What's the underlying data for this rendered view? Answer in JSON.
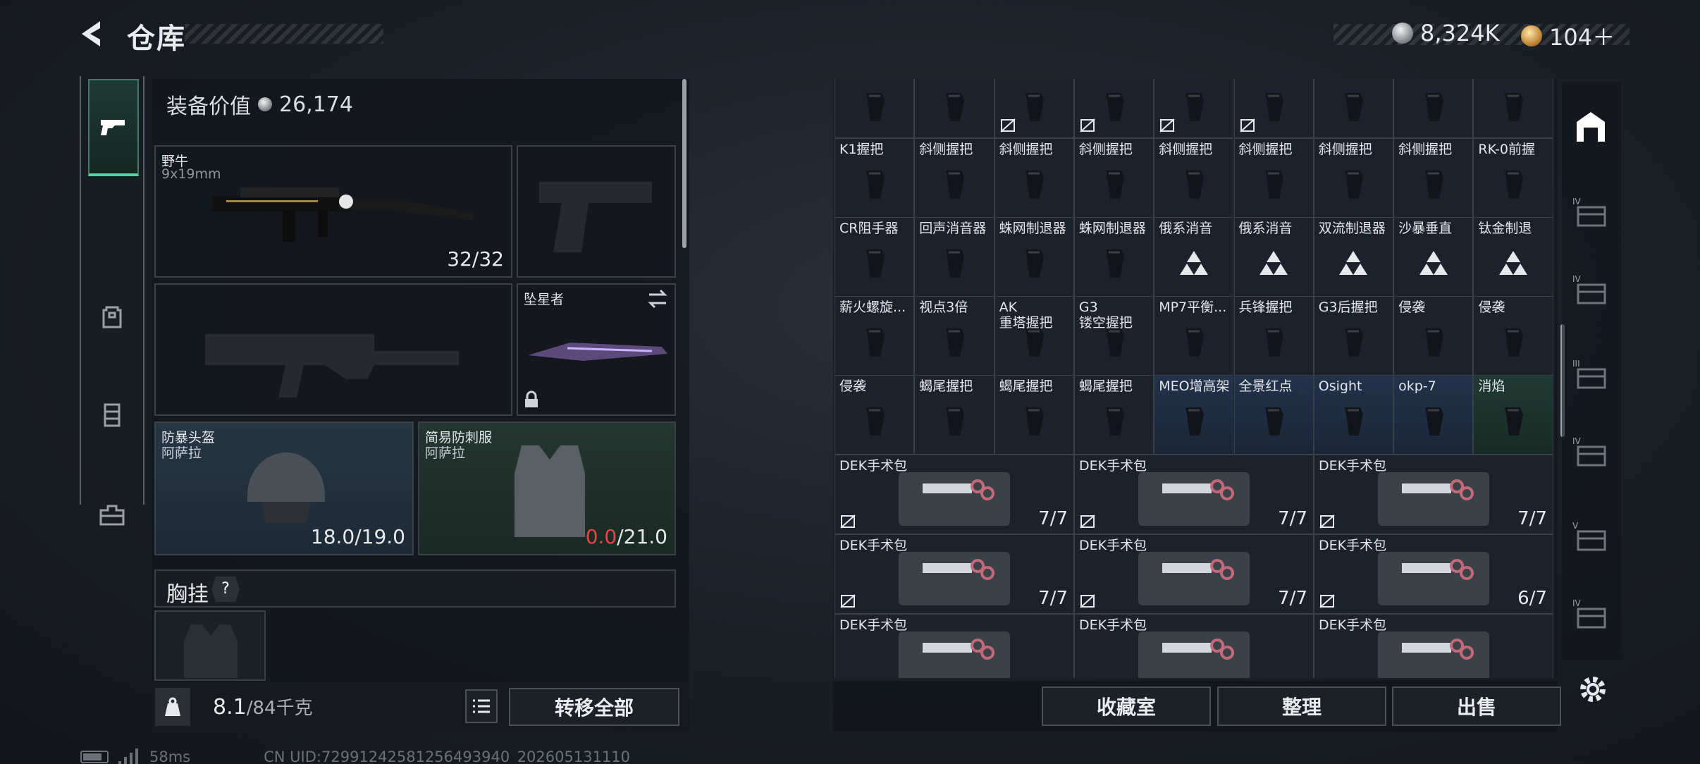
{
  "header": {
    "title": "仓库"
  },
  "currency": {
    "silver": "8,324K",
    "gold": "104＋"
  },
  "equipment": {
    "value_label": "装备价值",
    "value": "26,174",
    "primary": {
      "name": "野牛",
      "ammo": "9x19mm",
      "count": "32/32"
    },
    "melee": {
      "name": "坠星者"
    },
    "helmet": {
      "name": "防暴头盔",
      "brand": "阿萨拉",
      "count": "18.0/19.0"
    },
    "armor": {
      "name": "简易防刺服",
      "brand": "阿萨拉",
      "count_current": "0.0",
      "count_max": "/21.0"
    },
    "chest_label": "胸挂",
    "chest_help": "?"
  },
  "bottom_left": {
    "weight": "8.1",
    "weight_max": "/84千克",
    "transfer_all": "转移全部"
  },
  "status": {
    "ping": "58ms",
    "uid": "CN UID:72991242581256493940_202605131110"
  },
  "grid": {
    "row1": [
      "",
      "",
      "",
      "",
      "",
      "",
      "",
      "",
      ""
    ],
    "row2": [
      "K1握把",
      "斜侧握把",
      "斜侧握把",
      "斜侧握把",
      "斜侧握把",
      "斜侧握把",
      "斜侧握把",
      "斜侧握把",
      "RK-0前握"
    ],
    "row3": [
      "CR阻手器",
      "回声消音器",
      "蛛网制退器",
      "蛛网制退器",
      "俄系消音",
      "俄系消音",
      "双流制退器",
      "沙暴垂直",
      "钛金制退"
    ],
    "row4": [
      "薪火螺旋...",
      "视点3倍",
      "AK\n重塔握把",
      "G3\n镂空握把",
      "MP7平衡...",
      "兵锋握把",
      "G3后握把",
      "侵袭",
      "侵袭"
    ],
    "row5": [
      "侵袭",
      "蝎尾握把",
      "蝎尾握把",
      "蝎尾握把",
      "MEO增高架",
      "全景红点",
      "Osight",
      "okp-7",
      "消焰"
    ],
    "kits": [
      {
        "name": "DEK手术包",
        "count": "7/7"
      },
      {
        "name": "DEK手术包",
        "count": "7/7"
      },
      {
        "name": "DEK手术包",
        "count": "7/7"
      },
      {
        "name": "DEK手术包",
        "count": "7/7"
      },
      {
        "name": "DEK手术包",
        "count": "7/7"
      },
      {
        "name": "DEK手术包",
        "count": "6/7"
      },
      {
        "name": "DEK手术包",
        "count": ""
      },
      {
        "name": "DEK手术包",
        "count": ""
      },
      {
        "name": "DEK手术包",
        "count": ""
      }
    ]
  },
  "buttons": {
    "vault": "收藏室",
    "sort": "整理",
    "sell": "出售"
  },
  "right_tabs": [
    "IV",
    "IV",
    "III",
    "IV",
    "V",
    "IV"
  ]
}
